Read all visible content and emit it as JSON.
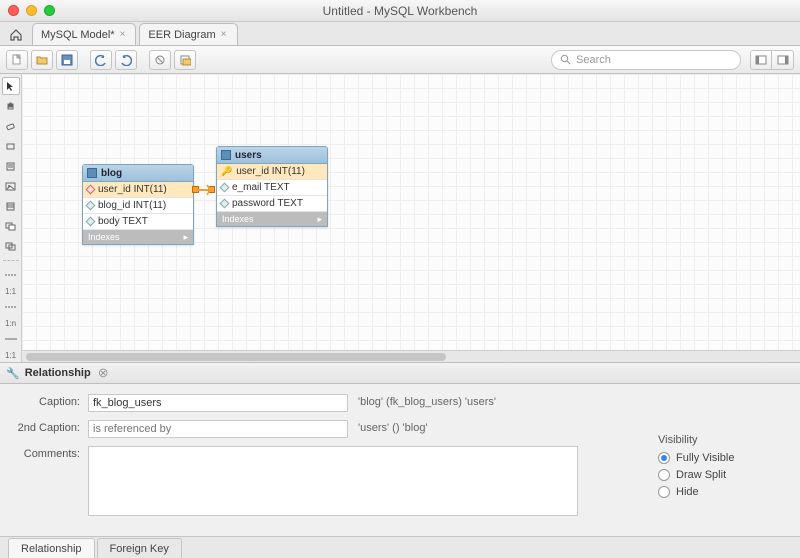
{
  "title": "Untitled - MySQL Workbench",
  "tabs": [
    {
      "label": "MySQL Model*"
    },
    {
      "label": "EER Diagram"
    }
  ],
  "search": {
    "placeholder": "Search"
  },
  "side_labels": {
    "one_one": "1:1",
    "one_n": "1:n",
    "one_one_b": "1:1"
  },
  "entities": {
    "blog": {
      "name": "blog",
      "rows": [
        {
          "name": "user_id INT(11)",
          "pk": true,
          "diamond": "teal"
        },
        {
          "name": "blog_id INT(11)",
          "pk": false,
          "diamond": "teal"
        },
        {
          "name": "body TEXT",
          "pk": false,
          "diamond": "teal"
        }
      ],
      "indexes": "Indexes"
    },
    "users": {
      "name": "users",
      "rows": [
        {
          "name": "user_id INT(11)",
          "pk": true,
          "key": true
        },
        {
          "name": "e_mail TEXT",
          "pk": false,
          "diamond": "teal"
        },
        {
          "name": "password TEXT",
          "pk": false,
          "diamond": "teal"
        }
      ],
      "indexes": "Indexes"
    }
  },
  "panel": {
    "title": "Relationship",
    "caption_label": "Caption:",
    "caption_value": "fk_blog_users",
    "caption_desc": "'blog'  (fk_blog_users)  'users'",
    "caption2_label": "2nd Caption:",
    "caption2_placeholder": "is referenced by",
    "caption2_desc": "'users' () 'blog'",
    "comments_label": "Comments:",
    "visibility": {
      "title": "Visibility",
      "options": [
        "Fully Visible",
        "Draw Split",
        "Hide"
      ],
      "selected": 0
    }
  },
  "bottom_tabs": [
    "Relationship",
    "Foreign Key"
  ]
}
